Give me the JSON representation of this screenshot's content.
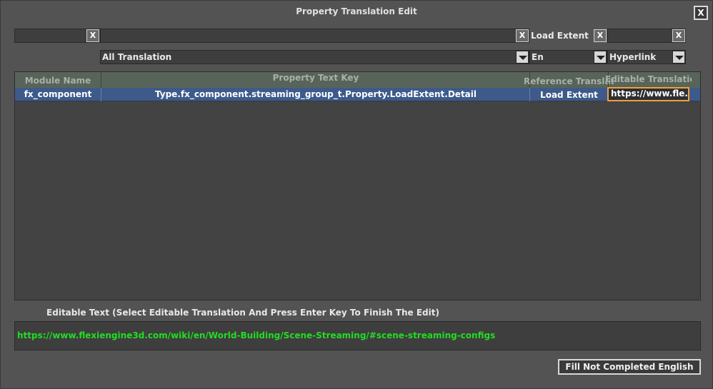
{
  "window": {
    "title": "Property Translation Edit",
    "close_label": "X"
  },
  "filters": {
    "module_filter_value": "",
    "key_filter_value": "",
    "reference_filter_value": "Load Extent",
    "editable_filter_value": "",
    "clear_label": "X"
  },
  "combos": {
    "translation_mode": "All Translation",
    "reference_language": "En",
    "editable_language": "Hyperlink"
  },
  "table": {
    "columns": [
      "Module Name",
      "Property Text Key",
      "Reference Translation",
      "Editable Translation"
    ],
    "rows": [
      {
        "module": "fx_component",
        "key": "Type.fx_component.streaming_group_t.Property.LoadExtent.Detail",
        "reference": "Load Extent",
        "editable": "https://www.fle..."
      }
    ]
  },
  "editor": {
    "label": "Editable Text (Select Editable Translation And Press Enter Key To Finish The Edit)",
    "value": "https://www.flexiengine3d.com/wiki/en/World-Building/Scene-Streaming/#scene-streaming-configs",
    "value_color": "#22dd22"
  },
  "actions": {
    "fill_label": "Fill Not Completed English"
  },
  "colors": {
    "selected_row": "#3d5a8a",
    "header": "#586459",
    "edit_highlight": "#f0a040"
  }
}
